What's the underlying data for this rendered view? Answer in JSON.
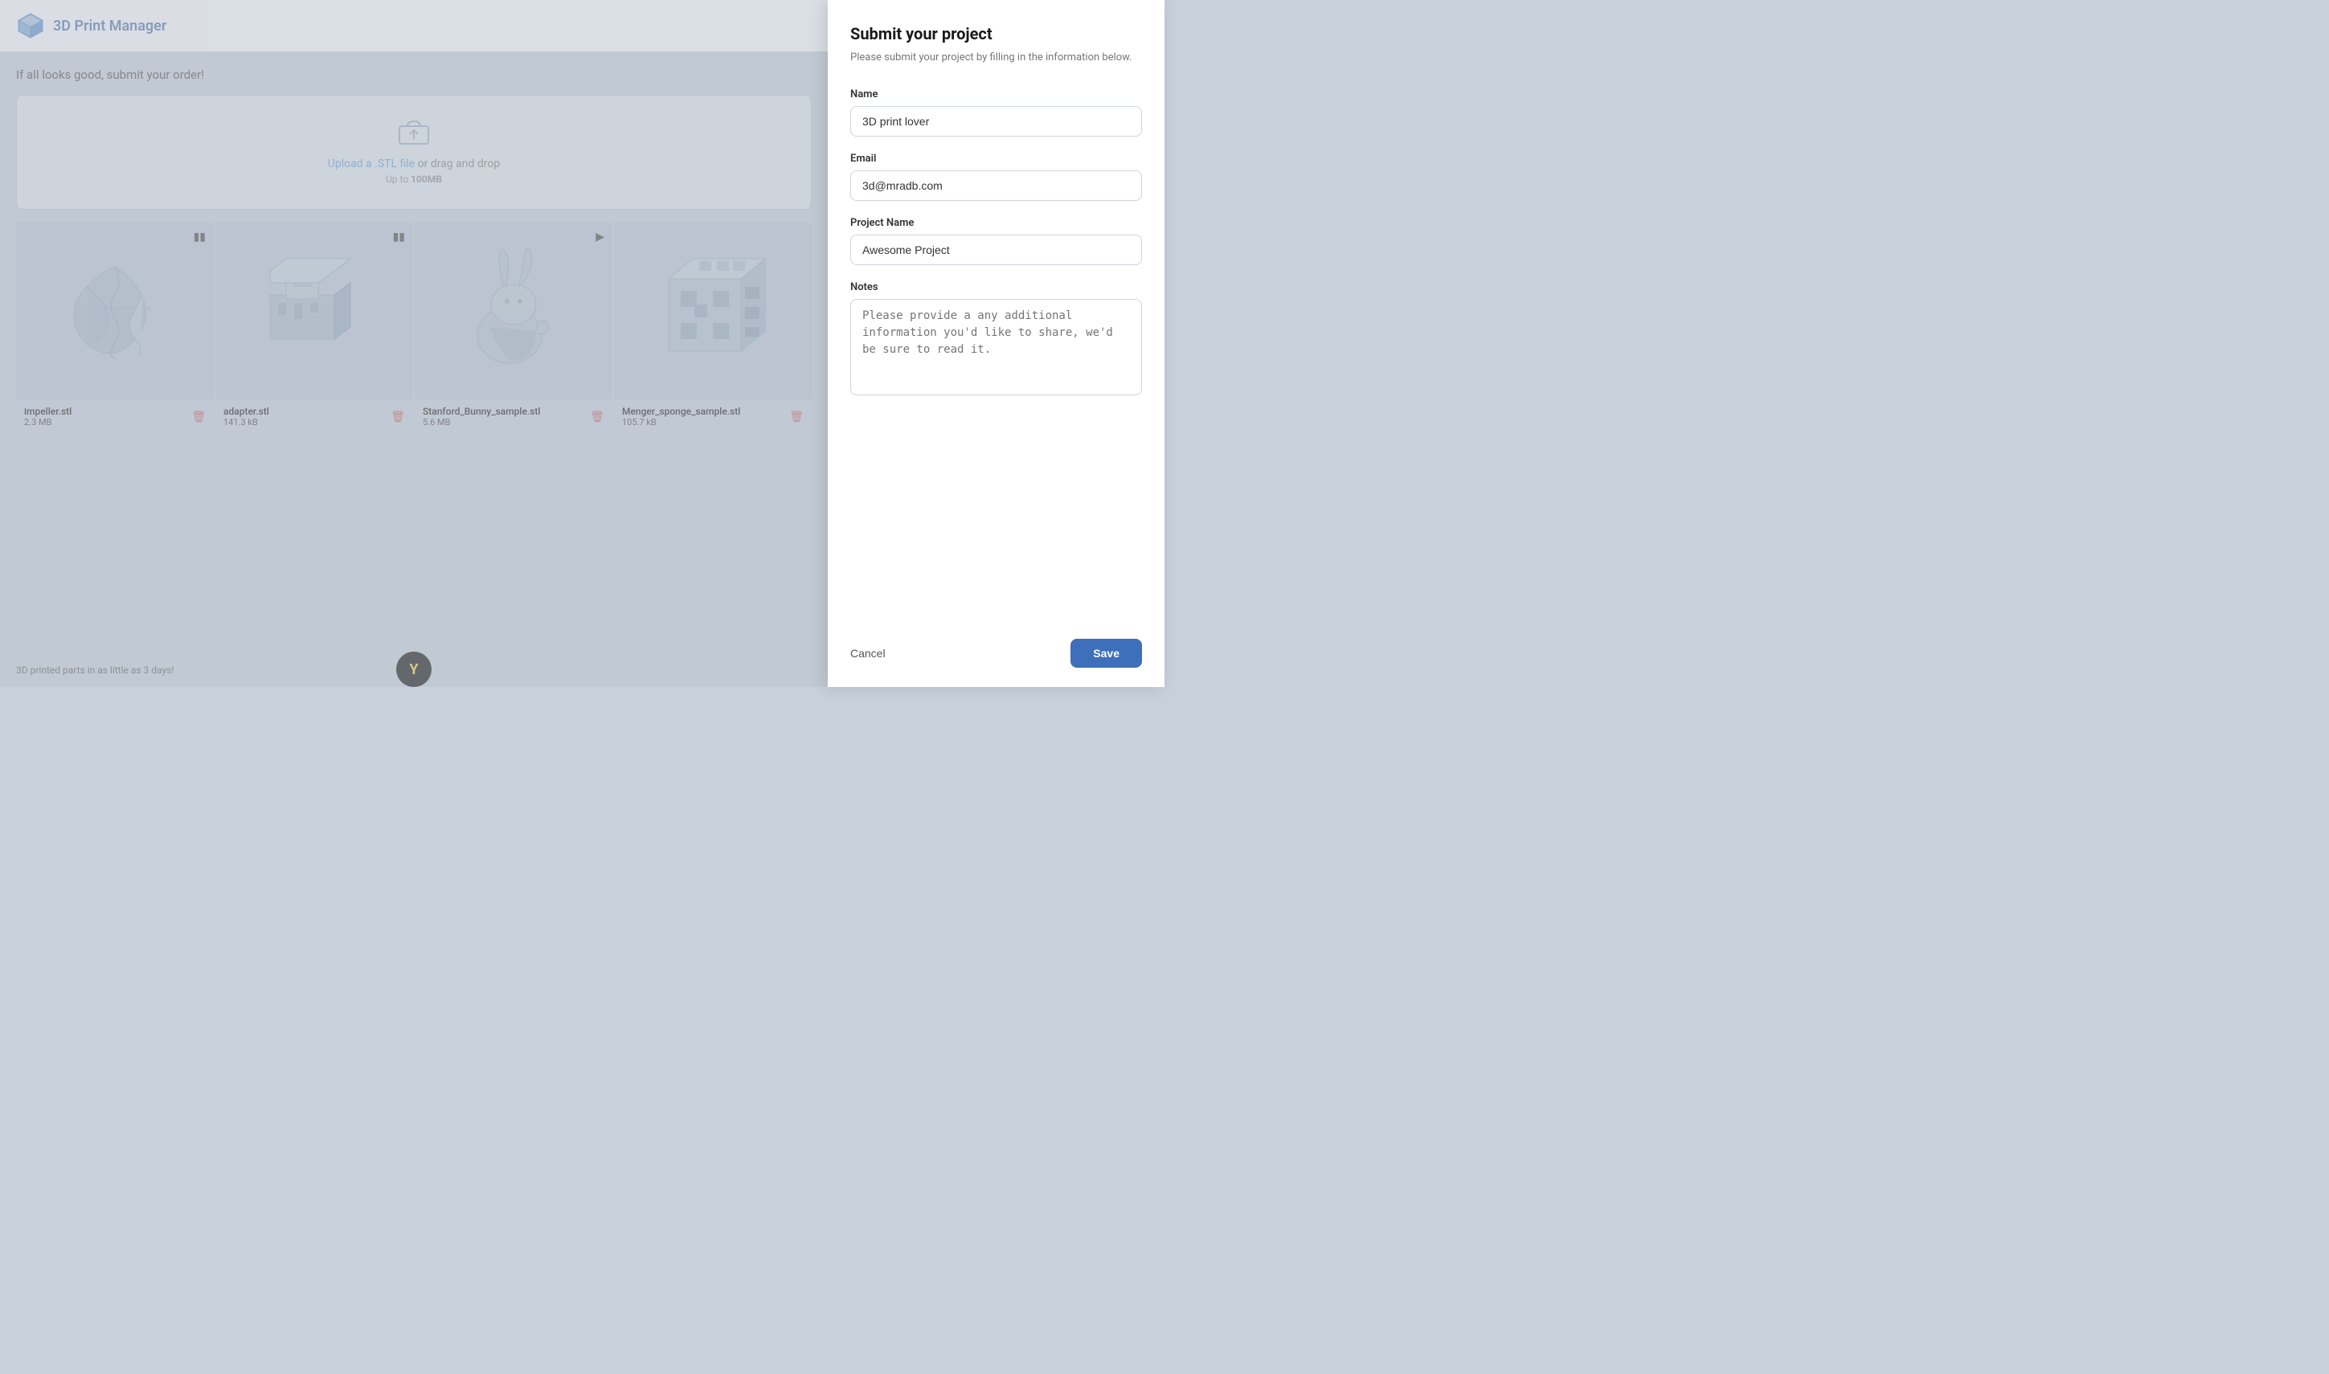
{
  "app": {
    "title": "3D Print Manager",
    "logo_alt": "3D cube logo"
  },
  "left": {
    "subtitle": "If all looks good, submit your order!",
    "upload": {
      "link_text": "Upload a .STL file",
      "rest_text": " or drag and drop",
      "size_label": "Up to ",
      "size_value": "100MB"
    },
    "models": [
      {
        "name": "impeller.stl",
        "size": "2.3 MB",
        "control": "pause"
      },
      {
        "name": "adapter.stl",
        "size": "141.3 kB",
        "control": "pause"
      },
      {
        "name": "Stanford_Bunny_sample.stl",
        "size": "5.6 MB",
        "control": "play"
      },
      {
        "name": "Menger_sponge_sample.stl",
        "size": "105.7 kB",
        "control": "none"
      }
    ],
    "footer": "3D printed parts in as little as 3 days!"
  },
  "form": {
    "title": "Submit your project",
    "subtitle": "Please submit your project by filling in the information below.",
    "name_label": "Name",
    "name_value": "3D print lover",
    "email_label": "Email",
    "email_value": "3d@mradb.com",
    "project_name_label": "Project Name",
    "project_name_value": "Awesome Project",
    "notes_label": "Notes",
    "notes_placeholder": "Please provide a any additional information you'd like to share, we'd be sure to read it.",
    "cancel_label": "Cancel",
    "save_label": "Save"
  }
}
